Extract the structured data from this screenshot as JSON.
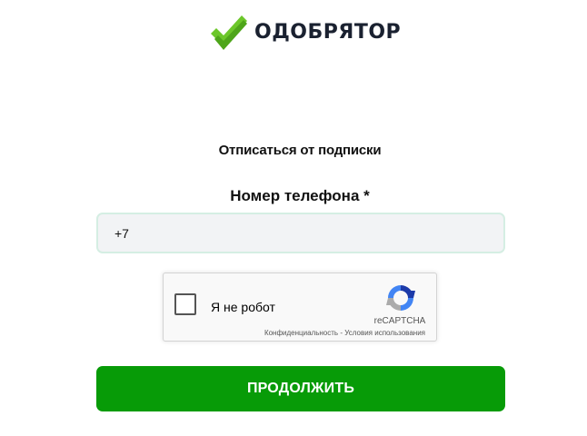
{
  "brand": {
    "name": "ОДОБРЯТОР",
    "logo_icon": "double-checkmark-icon",
    "accent_color": "#6cc72a",
    "text_color": "#1a2130"
  },
  "form": {
    "heading": "Отписаться от подписки",
    "phone_label": "Номер телефона *",
    "phone_value": "+7",
    "submit_label": "ПРОДОЛЖИТЬ",
    "submit_color": "#079b07"
  },
  "recaptcha": {
    "checkbox_label": "Я не робот",
    "brand": "reCAPTCHA",
    "privacy_link": "Конфиденциальность",
    "separator": " - ",
    "terms_link": "Условия использования",
    "checked": false
  }
}
